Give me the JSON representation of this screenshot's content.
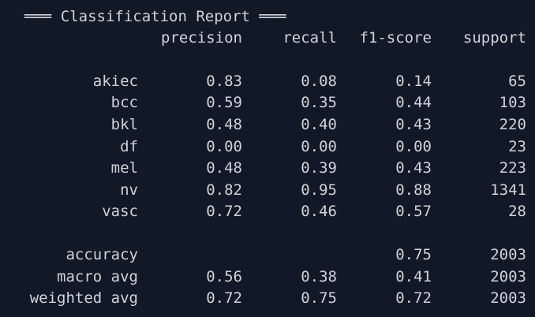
{
  "report": {
    "title": "═══ Classification Report ═══",
    "headers": {
      "precision": "precision",
      "recall": "recall",
      "f1": "f1-score",
      "support": "support"
    },
    "classes": [
      {
        "label": "akiec",
        "precision": "0.83",
        "recall": "0.08",
        "f1": "0.14",
        "support": "65"
      },
      {
        "label": "bcc",
        "precision": "0.59",
        "recall": "0.35",
        "f1": "0.44",
        "support": "103"
      },
      {
        "label": "bkl",
        "precision": "0.48",
        "recall": "0.40",
        "f1": "0.43",
        "support": "220"
      },
      {
        "label": "df",
        "precision": "0.00",
        "recall": "0.00",
        "f1": "0.00",
        "support": "23"
      },
      {
        "label": "mel",
        "precision": "0.48",
        "recall": "0.39",
        "f1": "0.43",
        "support": "223"
      },
      {
        "label": "nv",
        "precision": "0.82",
        "recall": "0.95",
        "f1": "0.88",
        "support": "1341"
      },
      {
        "label": "vasc",
        "precision": "0.72",
        "recall": "0.46",
        "f1": "0.57",
        "support": "28"
      }
    ],
    "summary": [
      {
        "label": "accuracy",
        "precision": "",
        "recall": "",
        "f1": "0.75",
        "support": "2003"
      },
      {
        "label": "macro avg",
        "precision": "0.56",
        "recall": "0.38",
        "f1": "0.41",
        "support": "2003"
      },
      {
        "label": "weighted avg",
        "precision": "0.72",
        "recall": "0.75",
        "f1": "0.72",
        "support": "2003"
      }
    ]
  },
  "colors": {
    "background": "#111827",
    "text": "#cdd3dc"
  }
}
